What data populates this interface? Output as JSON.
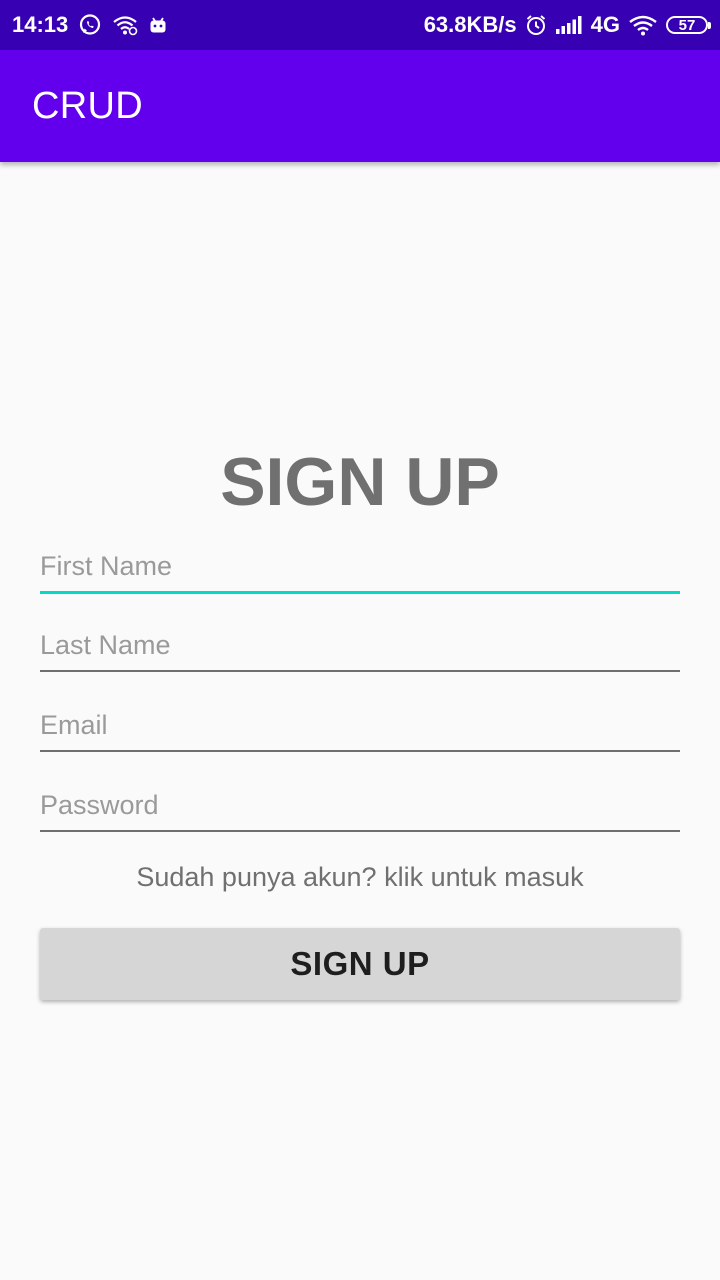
{
  "status_bar": {
    "time": "14:13",
    "net_speed": "63.8KB/s",
    "network_type": "4G",
    "battery": "57",
    "icons_left": [
      "whatsapp-icon",
      "wifi-share-icon",
      "android-icon"
    ],
    "icons_right": [
      "alarm-icon",
      "signal-icon",
      "wifi-icon",
      "battery-icon"
    ]
  },
  "app_bar": {
    "title": "CRUD",
    "color": "#6200ee"
  },
  "form": {
    "heading": "SIGN UP",
    "first_name_placeholder": "First Name",
    "last_name_placeholder": "Last Name",
    "email_placeholder": "Email",
    "password_placeholder": "Password",
    "login_link": "Sudah punya akun? klik untuk masuk",
    "submit_label": "SIGN UP",
    "focus_color": "#03dac5"
  }
}
